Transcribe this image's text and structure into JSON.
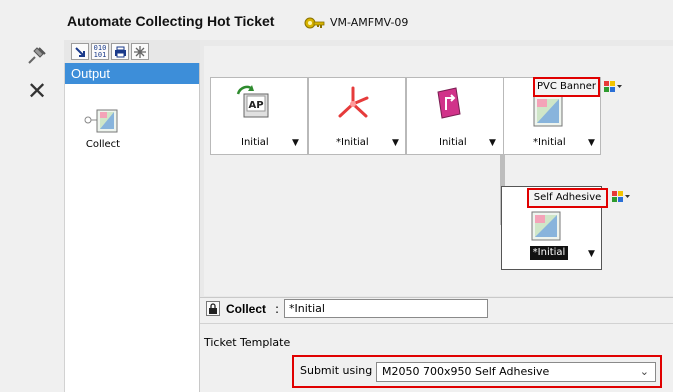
{
  "header": {
    "title": "Automate Collecting Hot Ticket",
    "hotfolder_id": "VM-AMFMV-09"
  },
  "palette": {
    "tabs": [
      "route-icon",
      "binary-icon",
      "printer-icon",
      "spark-icon"
    ],
    "section": "Output",
    "items": [
      {
        "label": "Collect",
        "icon": "collect-icon"
      }
    ]
  },
  "workflow": {
    "nodes": [
      {
        "label": "Initial",
        "icon": "ap-import-icon"
      },
      {
        "label": "*Initial",
        "icon": "ripper-icon"
      },
      {
        "label": "Initial",
        "icon": "routing-icon"
      },
      {
        "label": "*Initial",
        "icon": "collect-icon",
        "tag": "PVC Banner"
      },
      {
        "label": "*Initial",
        "icon": "collect-icon",
        "tag": "Self Adhesive"
      }
    ]
  },
  "collect_bar": {
    "label": "Collect",
    "separator": ":",
    "value": "*Initial"
  },
  "ticket_template": {
    "heading": "Ticket Template",
    "submit_label": "Submit using",
    "selected": "M2050 700x950 Self Adhesive"
  },
  "colors": {
    "accent": "#3d8ed9",
    "highlight": "#e00000"
  }
}
